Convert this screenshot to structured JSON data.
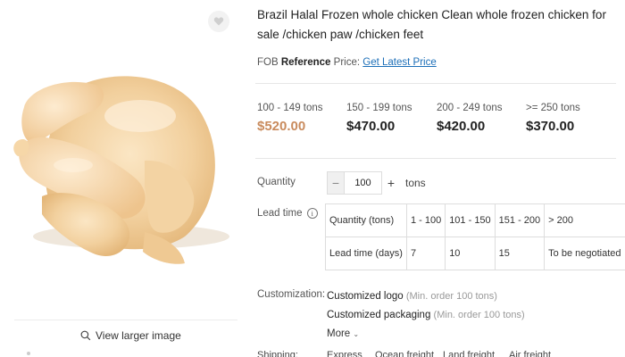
{
  "product": {
    "title": "Brazil Halal Frozen whole chicken Clean whole frozen chicken for sale /chicken paw /chicken feet",
    "image_alt": "Frozen whole chicken",
    "view_larger_label": "View larger image"
  },
  "fob": {
    "prefix": "FOB",
    "reference_label": "Reference",
    "price_label": "Price:",
    "link_label": "Get Latest Price"
  },
  "price_tiers": [
    {
      "range": "100 - 149 tons",
      "price": "$520.00"
    },
    {
      "range": "150 - 199 tons",
      "price": "$470.00"
    },
    {
      "range": "200 - 249 tons",
      "price": "$420.00"
    },
    {
      "range": ">= 250 tons",
      "price": "$370.00"
    }
  ],
  "quantity": {
    "label": "Quantity",
    "minus": "−",
    "value": "100",
    "plus": "+",
    "unit": "tons"
  },
  "lead_time": {
    "label": "Lead time",
    "info": "i",
    "row1": [
      "Quantity (tons)",
      "1 - 100",
      "101 - 150",
      "151 - 200",
      "> 200"
    ],
    "row2": [
      "Lead time (days)",
      "7",
      "10",
      "15",
      "To be negotiated"
    ]
  },
  "customization": {
    "label": "Customization:",
    "logo": "Customized logo",
    "logo_note": "(Min. order 100 tons)",
    "packaging": "Customized packaging",
    "packaging_note": "(Min. order 100 tons)",
    "more": "More"
  },
  "shipping": {
    "label": "Shipping:",
    "options": [
      "Express",
      "Ocean freight",
      "Land freight",
      "Air freight"
    ]
  },
  "colors": {
    "accent_price": "#c98b5d",
    "link": "#1d6fb8"
  }
}
